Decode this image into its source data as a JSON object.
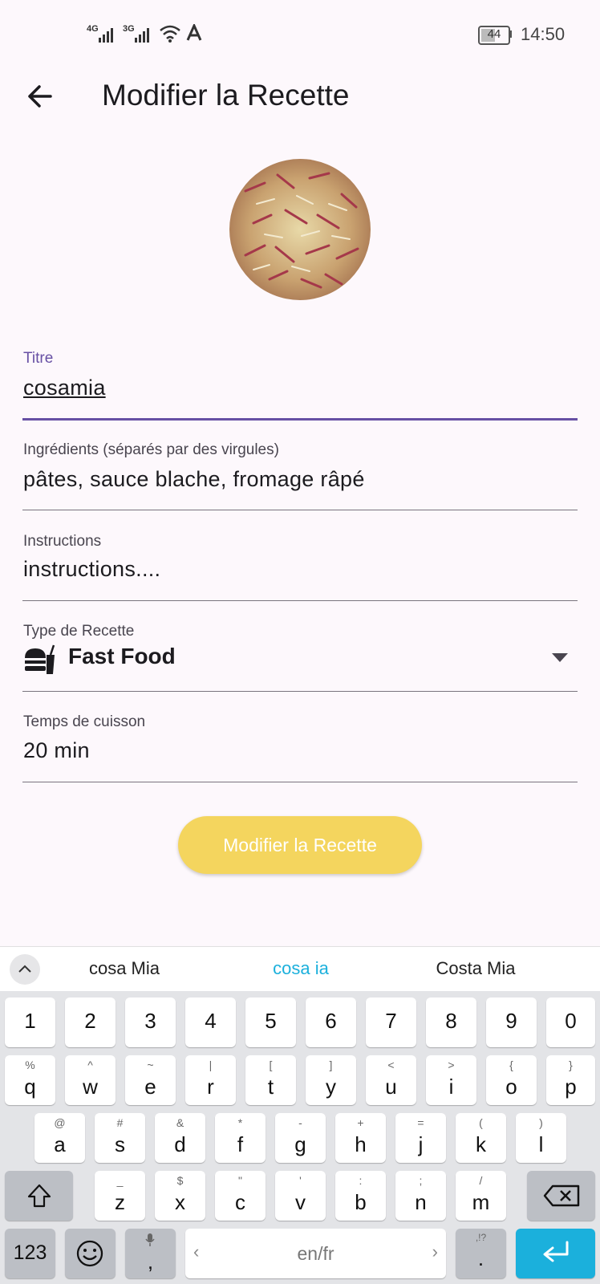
{
  "status_bar": {
    "net1": "4G",
    "net2": "3G",
    "battery": "44",
    "time": "14:50"
  },
  "app_bar": {
    "title": "Modifier la Recette",
    "back_icon": "arrow-left-icon"
  },
  "form": {
    "title_label": "Titre",
    "title_value": "cosamia",
    "ingredients_label": "Ingrédients (séparés par des virgules)",
    "ingredients_value": "pâtes, sauce blache, fromage râpé",
    "instructions_label": "Instructions",
    "instructions_value": "instructions....",
    "type_label": "Type de Recette",
    "type_value": "Fast Food",
    "type_icon": "fast-food-icon",
    "time_label": "Temps de cuisson",
    "time_value": "20 min",
    "submit_label": "Modifier la Recette"
  },
  "colors": {
    "accent": "#6750a4",
    "button": "#f4d55e",
    "enter_key": "#1bb0dc"
  },
  "keyboard": {
    "suggestions": [
      "cosa Mia",
      "cosa ia",
      "Costa Mia"
    ],
    "row_numbers": [
      "1",
      "2",
      "3",
      "4",
      "5",
      "6",
      "7",
      "8",
      "9",
      "0"
    ],
    "row1": [
      "q",
      "w",
      "e",
      "r",
      "t",
      "y",
      "u",
      "i",
      "o",
      "p"
    ],
    "row1_sub": [
      "%",
      "^",
      "~",
      "|",
      "[",
      "]",
      "<",
      ">",
      "{",
      "}"
    ],
    "row2": [
      "a",
      "s",
      "d",
      "f",
      "g",
      "h",
      "j",
      "k",
      "l"
    ],
    "row2_sub": [
      "@",
      "#",
      "&",
      "*",
      "-",
      "+",
      "=",
      "(",
      ")"
    ],
    "row3": [
      "z",
      "x",
      "c",
      "v",
      "b",
      "n",
      "m"
    ],
    "row3_sub": [
      "_",
      "$",
      "\"",
      "'",
      ":",
      ";",
      "/"
    ],
    "mode_key": "123",
    "space_label": "en/fr",
    "comma_key": ",",
    "period_key": ".",
    "period_sub": ",!?"
  }
}
